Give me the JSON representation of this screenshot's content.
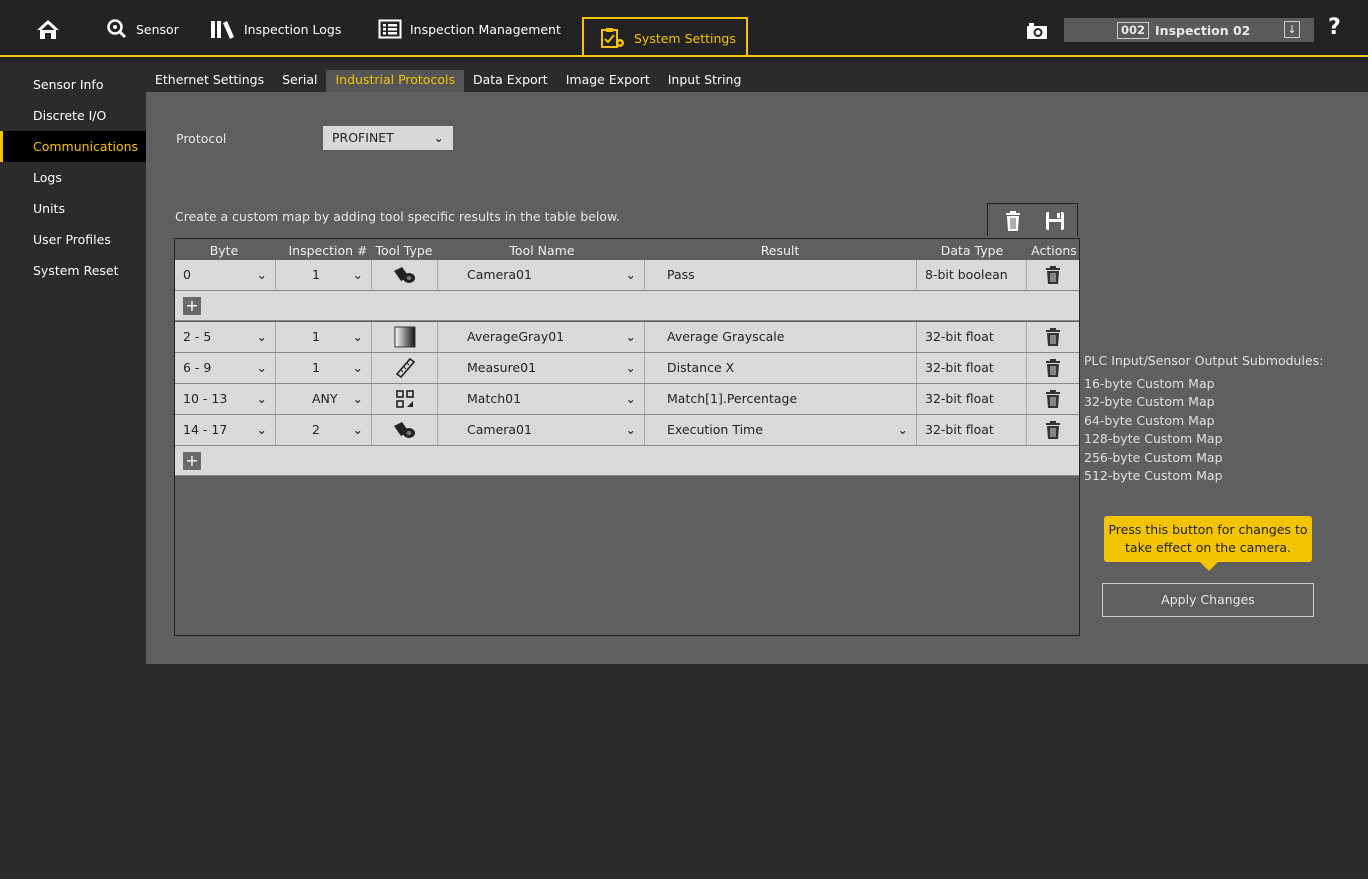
{
  "nav": {
    "home_icon": "home-icon",
    "sensor": "Sensor",
    "inspection_logs": "Inspection Logs",
    "inspection_management": "Inspection Management",
    "system_settings": "System Settings",
    "inspection_number": "002",
    "inspection_name": "Inspection 02",
    "help": "?"
  },
  "sidebar": {
    "items": [
      {
        "label": "Sensor Info"
      },
      {
        "label": "Discrete I/O"
      },
      {
        "label": "Communications",
        "active": true
      },
      {
        "label": "Logs"
      },
      {
        "label": "Units"
      },
      {
        "label": "User Profiles"
      },
      {
        "label": "System Reset"
      }
    ]
  },
  "tabs": [
    {
      "label": "Ethernet Settings"
    },
    {
      "label": "Serial"
    },
    {
      "label": "Industrial Protocols",
      "active": true
    },
    {
      "label": "Data Export"
    },
    {
      "label": "Image Export"
    },
    {
      "label": "Input String"
    }
  ],
  "protocol": {
    "label": "Protocol",
    "value": "PROFINET"
  },
  "description": "Create a custom map by adding tool specific results in the table below.",
  "table": {
    "headers": {
      "byte": "Byte",
      "inspection": "Inspection #",
      "tool_type": "Tool Type",
      "tool_name": "Tool Name",
      "result": "Result",
      "data_type": "Data Type",
      "actions": "Actions"
    },
    "add_label": "+",
    "rows": [
      {
        "byte": "0",
        "inspection": "1",
        "tool_icon": "camera-tool-icon",
        "tool_name": "Camera01",
        "result": "Pass",
        "data_type": "8-bit boolean"
      },
      {
        "byte": "2 - 5",
        "inspection": "1",
        "tool_icon": "average-gray-tool-icon",
        "tool_name": "AverageGray01",
        "result": "Average Grayscale",
        "data_type": "32-bit float"
      },
      {
        "byte": "6 - 9",
        "inspection": "1",
        "tool_icon": "measure-tool-icon",
        "tool_name": "Measure01",
        "result": "Distance X",
        "data_type": "32-bit float"
      },
      {
        "byte": "10 - 13",
        "inspection": "ANY",
        "tool_icon": "match-tool-icon",
        "tool_name": "Match01",
        "result": "Match[1].Percentage",
        "data_type": "32-bit float"
      },
      {
        "byte": "14 - 17",
        "inspection": "2",
        "tool_icon": "camera-tool-icon",
        "tool_name": "Camera01",
        "result": "Execution Time",
        "data_type": "32-bit float"
      }
    ]
  },
  "submodules": {
    "title": "PLC Input/Sensor Output Submodules:",
    "items": [
      "16-byte Custom Map",
      "32-byte Custom Map",
      "64-byte Custom Map",
      "128-byte Custom Map",
      "256-byte Custom Map",
      "512-byte Custom Map"
    ]
  },
  "tooltip": {
    "line1": "Press this button for changes to",
    "line2": "take effect on the camera."
  },
  "apply_button": "Apply Changes",
  "colors": {
    "accent": "#f4c400",
    "panel": "#5f5f5f",
    "background": "#2b2b2b"
  }
}
